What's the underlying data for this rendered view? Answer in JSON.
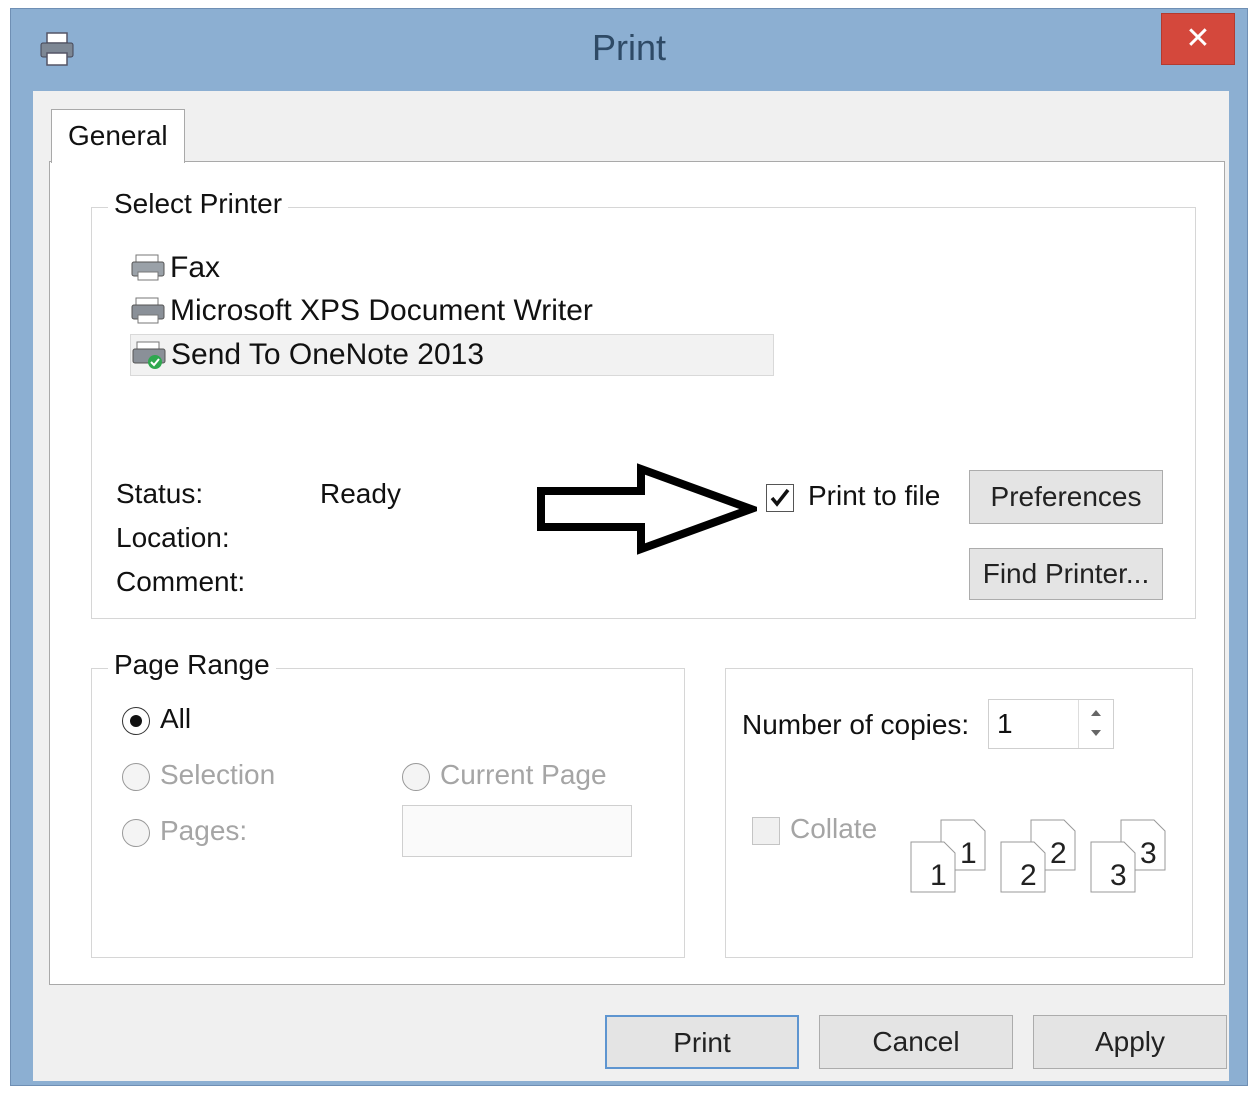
{
  "window": {
    "title": "Print",
    "close_label": "✕"
  },
  "tabs": [
    {
      "label": "General"
    }
  ],
  "select_printer": {
    "legend": "Select Printer",
    "printers": [
      {
        "name": "Fax",
        "icon": "fax-printer-icon"
      },
      {
        "name": "Microsoft XPS Document Writer",
        "icon": "printer-icon"
      },
      {
        "name": "Send To OneNote 2013",
        "icon": "onenote-printer-icon",
        "selected": true
      }
    ],
    "status_label": "Status:",
    "status_value": "Ready",
    "location_label": "Location:",
    "comment_label": "Comment:",
    "print_to_file": {
      "label": "Print to file",
      "checked": true
    },
    "preferences_label": "Preferences",
    "find_printer_label": "Find Printer..."
  },
  "page_range": {
    "legend": "Page Range",
    "all_label": "All",
    "selection_label": "Selection",
    "current_page_label": "Current Page",
    "pages_label": "Pages:",
    "pages_value": ""
  },
  "copies": {
    "number_label": "Number of copies:",
    "number_value": "1",
    "collate_label": "Collate",
    "collate_checked": false,
    "collate_pages": [
      "1",
      "1",
      "2",
      "2",
      "3",
      "3"
    ]
  },
  "buttons": {
    "print": "Print",
    "cancel": "Cancel",
    "apply": "Apply"
  },
  "annotation": {
    "icon": "arrow-right-icon"
  },
  "colors": {
    "titlebar": "#8cafd2",
    "close": "#d4483c",
    "title_text": "#2e4a66"
  }
}
